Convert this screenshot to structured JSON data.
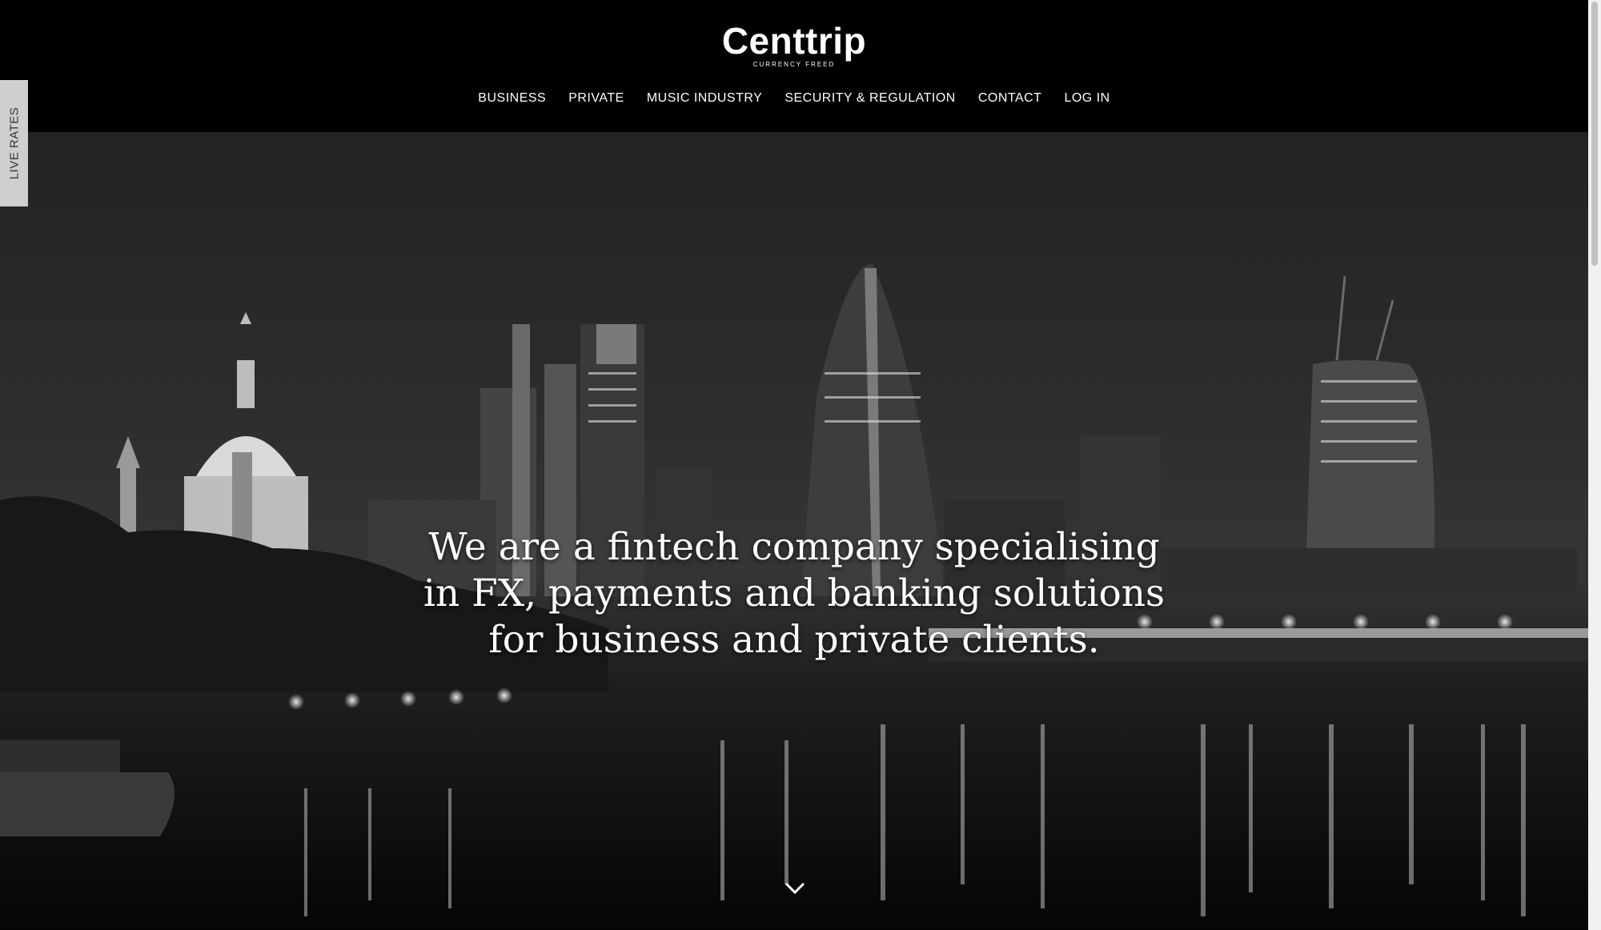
{
  "brand": {
    "name": "Centtrip",
    "tagline": "CURRENCY FREED"
  },
  "nav": {
    "items": [
      {
        "label": "BUSINESS"
      },
      {
        "label": "PRIVATE"
      },
      {
        "label": "MUSIC INDUSTRY"
      },
      {
        "label": "SECURITY & REGULATION"
      },
      {
        "label": "CONTACT"
      },
      {
        "label": "LOG IN"
      }
    ]
  },
  "side_tab": {
    "label": "LIVE RATES"
  },
  "hero": {
    "headline_lines": [
      "We are a fintech company specialising",
      "in FX, payments and banking solutions",
      "for business and private clients."
    ],
    "scroll_icon": "chevron-down-icon"
  },
  "colors": {
    "header_bg": "#000000",
    "text": "#ffffff",
    "side_tab_bg": "#cfcfcf"
  }
}
